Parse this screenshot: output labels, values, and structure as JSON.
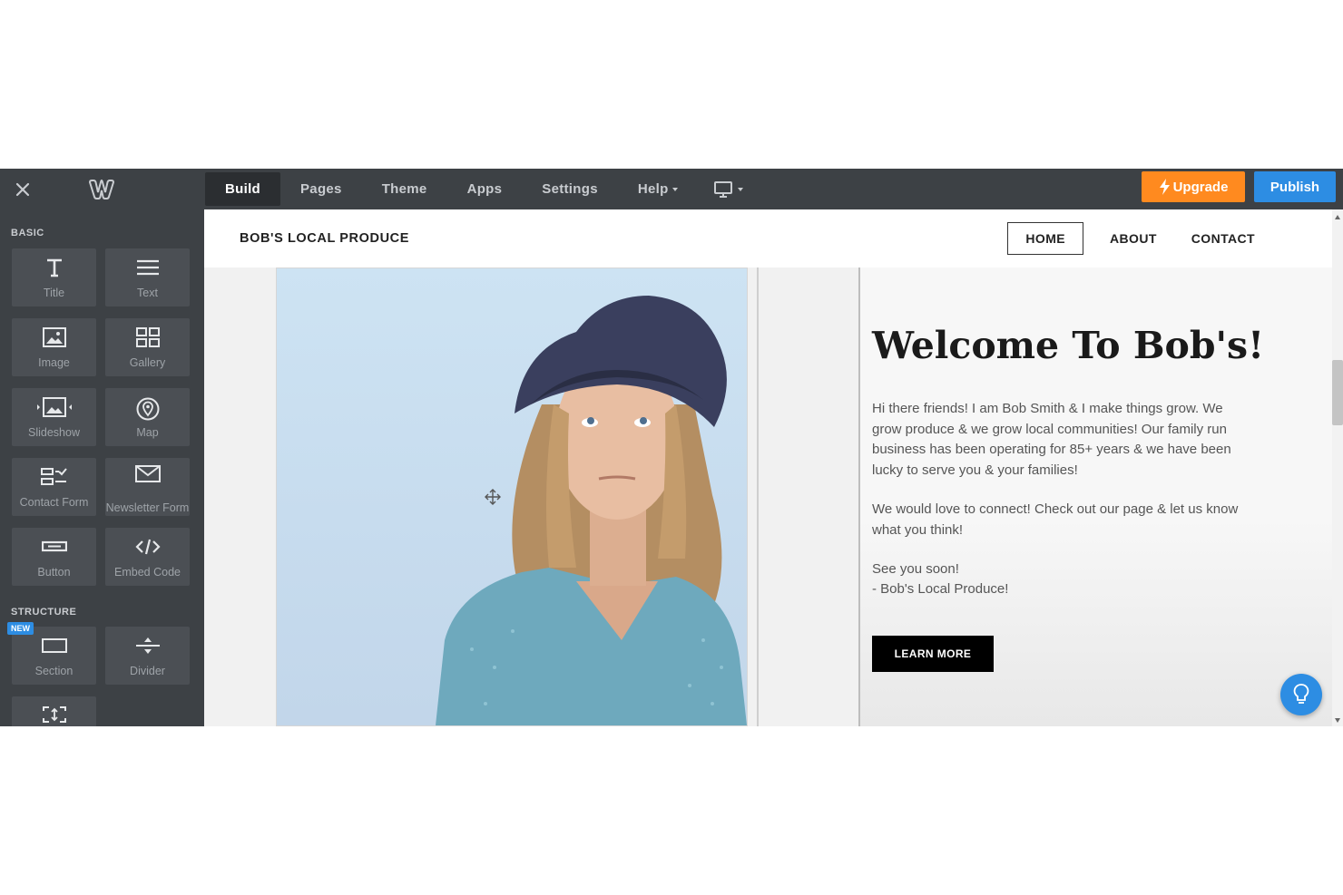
{
  "topbar": {
    "tabs": [
      {
        "label": "Build",
        "active": true
      },
      {
        "label": "Pages"
      },
      {
        "label": "Theme"
      },
      {
        "label": "Apps"
      },
      {
        "label": "Settings"
      },
      {
        "label": "Help"
      }
    ],
    "upgrade_label": "Upgrade",
    "publish_label": "Publish",
    "icons": {
      "close": "close-icon",
      "logo": "weebly-logo",
      "device": "desktop-icon",
      "upgrade": "bolt-icon"
    },
    "colors": {
      "bar": "#3d4145",
      "upgrade": "#ff8a1f",
      "publish": "#2d8de3"
    }
  },
  "sidebar": {
    "basic_label": "BASIC",
    "structure_label": "STRUCTURE",
    "new_badge": "NEW",
    "basic_items": [
      {
        "label": "Title",
        "icon": "title-icon"
      },
      {
        "label": "Text",
        "icon": "text-icon"
      },
      {
        "label": "Image",
        "icon": "image-icon"
      },
      {
        "label": "Gallery",
        "icon": "gallery-icon"
      },
      {
        "label": "Slideshow",
        "icon": "slideshow-icon"
      },
      {
        "label": "Map",
        "icon": "map-pin-icon"
      },
      {
        "label": "Contact Form",
        "icon": "contact-form-icon"
      },
      {
        "label": "Newsletter Form",
        "icon": "envelope-icon"
      },
      {
        "label": "Button",
        "icon": "button-icon"
      },
      {
        "label": "Embed Code",
        "icon": "code-icon"
      }
    ],
    "structure_items": [
      {
        "label": "Section",
        "icon": "section-icon"
      },
      {
        "label": "Divider",
        "icon": "divider-icon"
      },
      {
        "label": "",
        "icon": "spacer-icon"
      }
    ]
  },
  "site": {
    "brand": "BOB'S LOCAL PRODUCE",
    "nav": [
      {
        "label": "HOME",
        "active": true
      },
      {
        "label": "ABOUT"
      },
      {
        "label": "CONTACT"
      }
    ],
    "heading": "Welcome To Bob's!",
    "paragraphs": [
      "Hi there friends! I am Bob Smith & I make things grow. We grow produce & we grow local communities! Our family run business has been operating for 85+ years & we have been lucky to serve you & your families!",
      "We would love to connect! Check out our page & let us know what you think!",
      "See you soon!",
      "- Bob's Local Produce!"
    ],
    "cta_label": "LEARN MORE",
    "image": "portrait-photo"
  }
}
